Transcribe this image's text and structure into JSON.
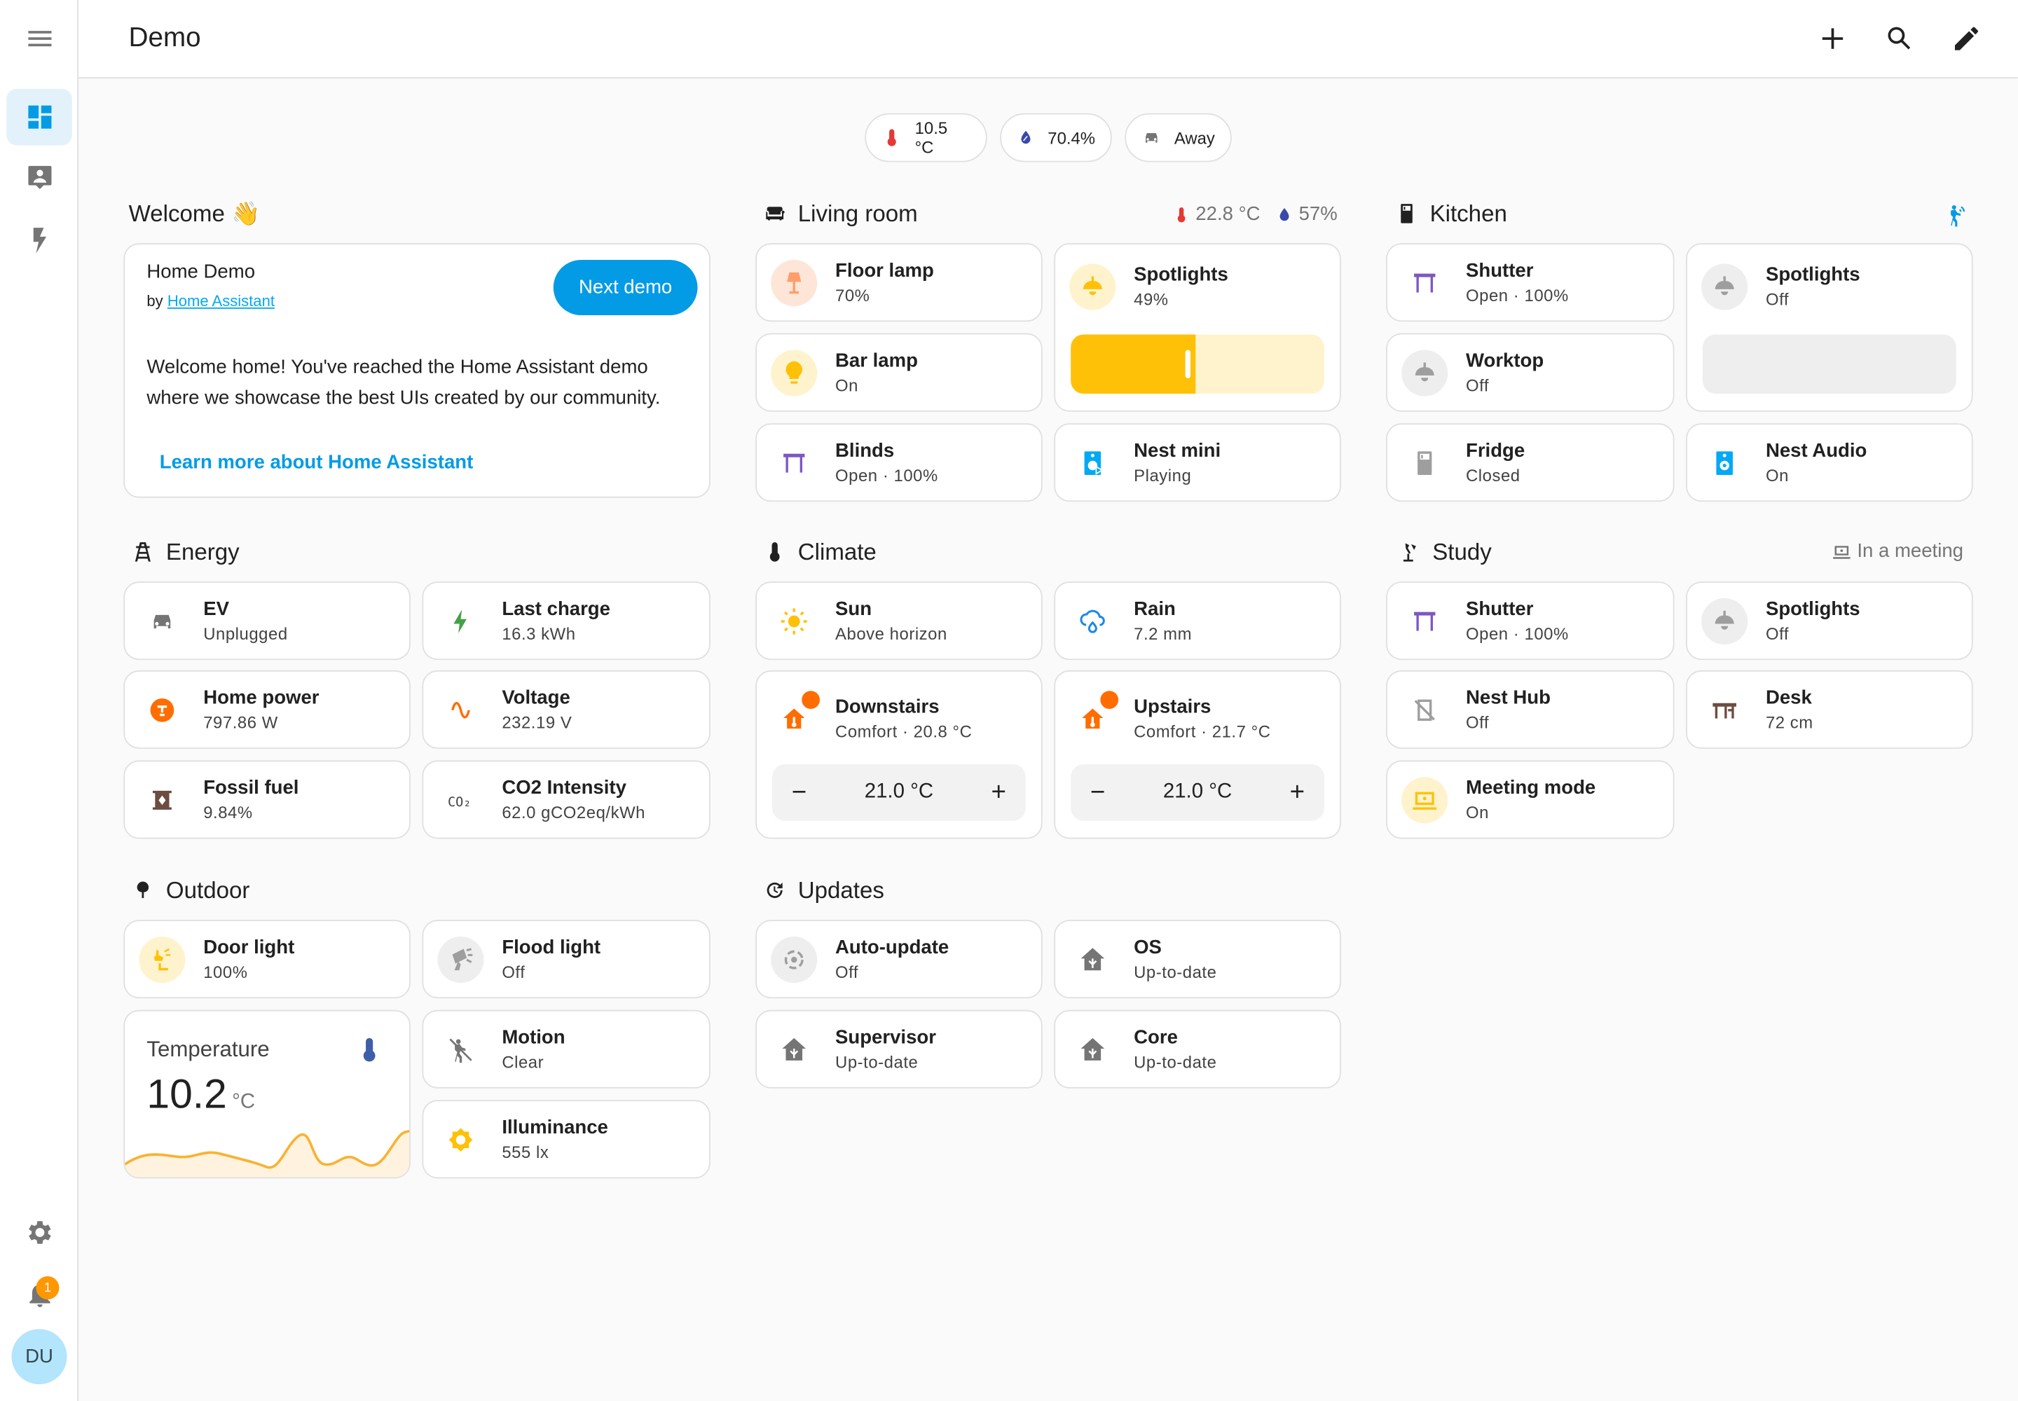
{
  "app": {
    "title": "Demo"
  },
  "sidebar": {
    "notification_count": "1",
    "avatar_initials": "DU"
  },
  "badges": [
    {
      "icon": "thermometer-icon",
      "value": "10.5 °C",
      "color": "#e53935"
    },
    {
      "icon": "water-percent-icon",
      "value": "70.4%",
      "color": "#3949ab"
    },
    {
      "icon": "car-icon",
      "value": "Away",
      "color": "#757575"
    }
  ],
  "welcome": {
    "section_title": "Welcome 👋",
    "title": "Home Demo",
    "by": "by",
    "author": "Home Assistant",
    "button": "Next demo",
    "body": "Welcome home! You've reached the Home Assistant demo where we showcase the best UIs created by our community.",
    "link": "Learn more about Home Assistant"
  },
  "living_room": {
    "title": "Living room",
    "temp": "22.8 °C",
    "humidity": "57%",
    "floor_lamp": {
      "name": "Floor lamp",
      "state": "70%"
    },
    "spotlights": {
      "name": "Spotlights",
      "state": "49%",
      "brightness": 0.49
    },
    "bar_lamp": {
      "name": "Bar lamp",
      "state": "On"
    },
    "blinds": {
      "name": "Blinds",
      "state": "Open · 100%"
    },
    "nest_mini": {
      "name": "Nest mini",
      "state": "Playing"
    }
  },
  "kitchen": {
    "title": "Kitchen",
    "shutter": {
      "name": "Shutter",
      "state": "Open · 100%"
    },
    "spotlights": {
      "name": "Spotlights",
      "state": "Off"
    },
    "worktop": {
      "name": "Worktop",
      "state": "Off"
    },
    "fridge": {
      "name": "Fridge",
      "state": "Closed"
    },
    "nest_audio": {
      "name": "Nest Audio",
      "state": "On"
    }
  },
  "energy": {
    "title": "Energy",
    "ev": {
      "name": "EV",
      "state": "Unplugged"
    },
    "last_charge": {
      "name": "Last charge",
      "state": "16.3 kWh"
    },
    "home_power": {
      "name": "Home power",
      "state": "797.86 W"
    },
    "voltage": {
      "name": "Voltage",
      "state": "232.19 V"
    },
    "fossil_fuel": {
      "name": "Fossil fuel",
      "state": "9.84%"
    },
    "co2": {
      "name": "CO2 Intensity",
      "state": "62.0 gCO2eq/kWh"
    }
  },
  "climate": {
    "title": "Climate",
    "sun": {
      "name": "Sun",
      "state": "Above horizon"
    },
    "rain": {
      "name": "Rain",
      "state": "7.2 mm"
    },
    "downstairs": {
      "name": "Downstairs",
      "state": "Comfort · 20.8 °C",
      "target": "21.0 °C"
    },
    "upstairs": {
      "name": "Upstairs",
      "state": "Comfort · 21.7 °C",
      "target": "21.0 °C"
    },
    "minus": "−",
    "plus": "+"
  },
  "study": {
    "title": "Study",
    "status": "In a meeting",
    "shutter": {
      "name": "Shutter",
      "state": "Open · 100%"
    },
    "spotlights": {
      "name": "Spotlights",
      "state": "Off"
    },
    "nest_hub": {
      "name": "Nest Hub",
      "state": "Off"
    },
    "desk": {
      "name": "Desk",
      "state": "72 cm"
    },
    "meeting_mode": {
      "name": "Meeting mode",
      "state": "On"
    }
  },
  "outdoor": {
    "title": "Outdoor",
    "door_light": {
      "name": "Door light",
      "state": "100%"
    },
    "flood_light": {
      "name": "Flood light",
      "state": "Off"
    },
    "motion": {
      "name": "Motion",
      "state": "Clear"
    },
    "illuminance": {
      "name": "Illuminance",
      "state": "555 lx"
    },
    "temperature": {
      "name": "Temperature",
      "value": "10.2",
      "unit": "°C"
    }
  },
  "updates": {
    "title": "Updates",
    "auto_update": {
      "name": "Auto-update",
      "state": "Off"
    },
    "os": {
      "name": "OS",
      "state": "Up-to-date"
    },
    "supervisor": {
      "name": "Supervisor",
      "state": "Up-to-date"
    },
    "core": {
      "name": "Core",
      "state": "Up-to-date"
    }
  },
  "colors": {
    "accent": "#039be5",
    "light_on": "#ffc107",
    "cover": "#7e57c2",
    "heat": "#ff6d00"
  }
}
